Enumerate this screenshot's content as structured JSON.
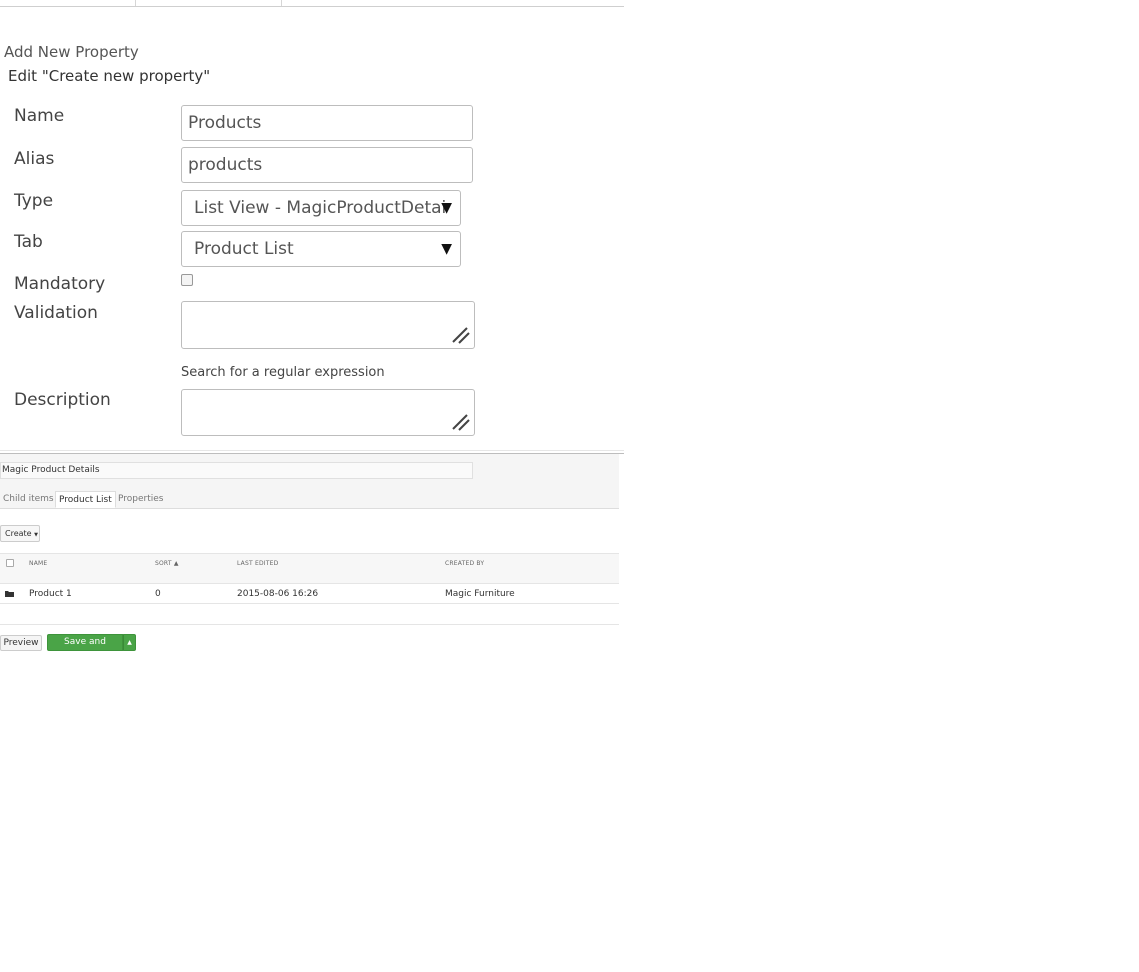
{
  "dialog": {
    "title": "Add New Property",
    "subtitle": "Edit \"Create new property\""
  },
  "form": {
    "name_label": "Name",
    "name_value": "Products",
    "alias_label": "Alias",
    "alias_value": "products",
    "type_label": "Type",
    "type_value": "List View - MagicProductDetai",
    "tab_label": "Tab",
    "tab_value": "Product List",
    "mandatory_label": "Mandatory",
    "mandatory_checked": false,
    "validation_label": "Validation",
    "validation_value": "",
    "validation_hint": "Search for a regular expression",
    "description_label": "Description",
    "description_value": ""
  },
  "editor": {
    "document_name": "Magic Product Details",
    "tabs": [
      {
        "label": "Child items",
        "active": false
      },
      {
        "label": "Product List",
        "active": true
      },
      {
        "label": "Properties",
        "active": false
      }
    ],
    "create_label": "Create",
    "table": {
      "columns": [
        "NAME",
        "SORT",
        "LAST EDITED",
        "CREATED BY"
      ],
      "sort_indicator": "▲",
      "rows": [
        {
          "icon": "folder-icon",
          "name": "Product 1",
          "sort": "0",
          "last_edited": "2015-08-06 16:26",
          "created_by": "Magic Furniture"
        }
      ]
    },
    "preview_label": "Preview",
    "save_label": "Save and publish"
  },
  "colors": {
    "save_button": "#4aa447",
    "border": "#bdbdbd",
    "panel_bg": "#f5f5f5"
  }
}
